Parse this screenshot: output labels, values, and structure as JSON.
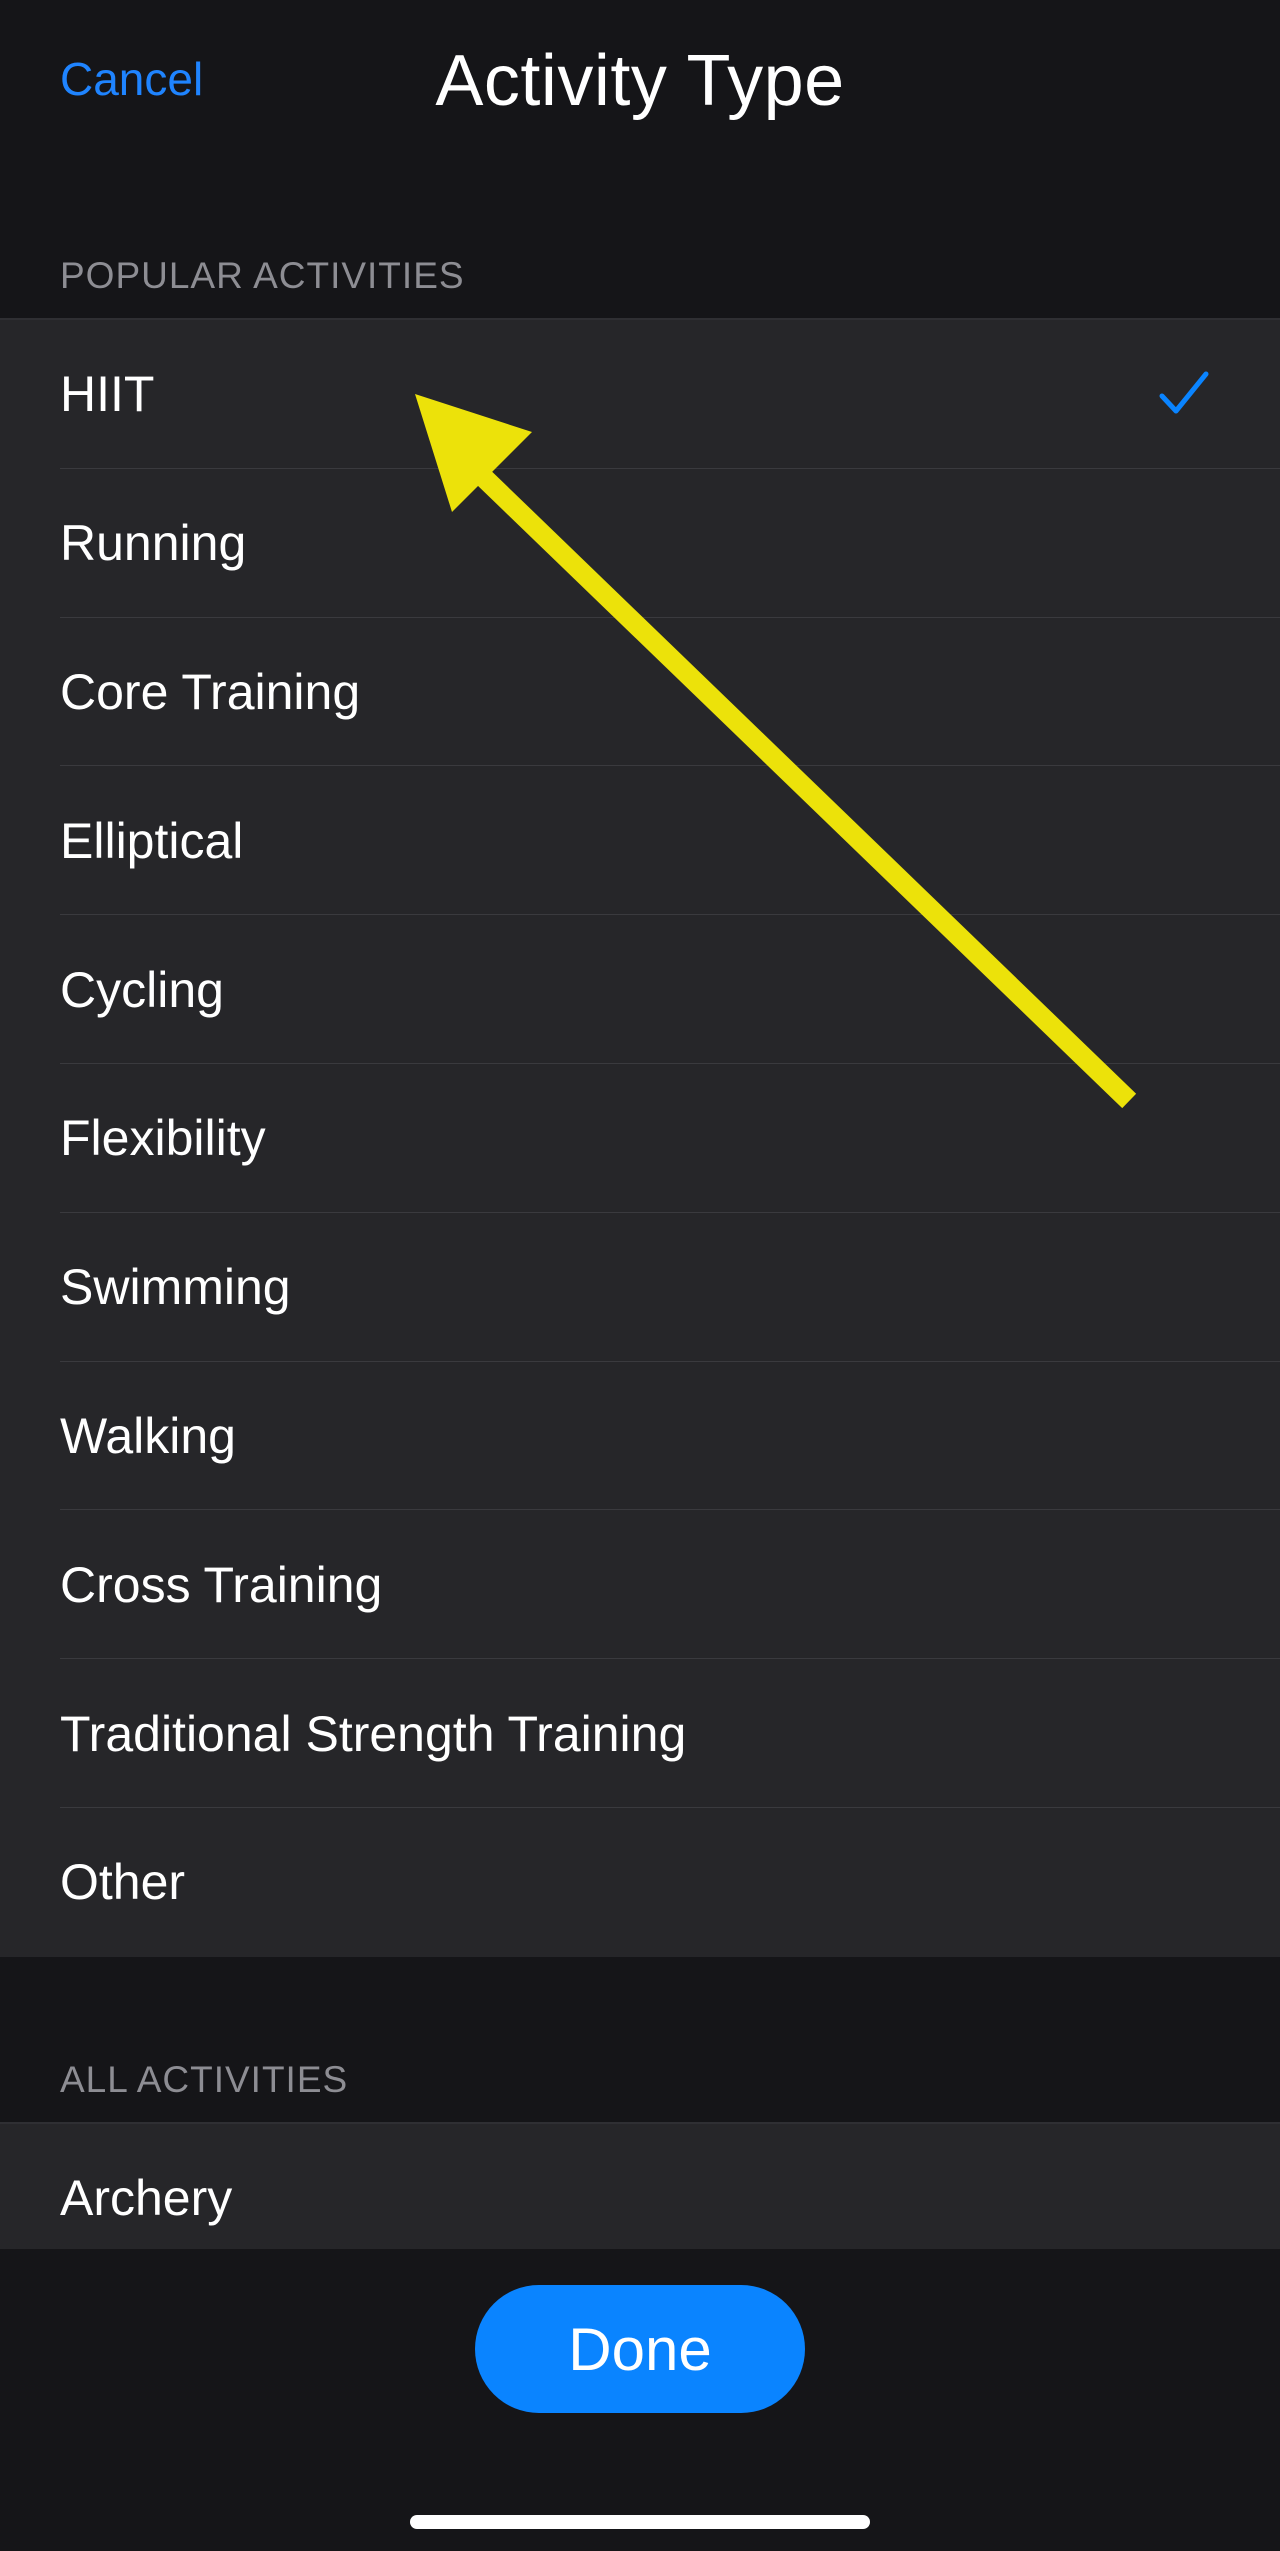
{
  "header": {
    "cancel_label": "Cancel",
    "title": "Activity Type"
  },
  "popular": {
    "header": "POPULAR ACTIVITIES",
    "items": [
      {
        "label": "HIIT",
        "selected": true
      },
      {
        "label": "Running",
        "selected": false
      },
      {
        "label": "Core Training",
        "selected": false
      },
      {
        "label": "Elliptical",
        "selected": false
      },
      {
        "label": "Cycling",
        "selected": false
      },
      {
        "label": "Flexibility",
        "selected": false
      },
      {
        "label": "Swimming",
        "selected": false
      },
      {
        "label": "Walking",
        "selected": false
      },
      {
        "label": "Cross Training",
        "selected": false
      },
      {
        "label": "Traditional Strength Training",
        "selected": false
      },
      {
        "label": "Other",
        "selected": false
      }
    ]
  },
  "all": {
    "header": "ALL ACTIVITIES",
    "items": [
      {
        "label": "Archery"
      }
    ]
  },
  "footer": {
    "done_label": "Done"
  },
  "icons": {
    "checkmark": "checkmark-icon"
  },
  "colors": {
    "accent": "#0a84ff",
    "link": "#1f84ff",
    "annotation_arrow": "#ece20a",
    "background": "#151518",
    "cell_background": "#262629",
    "secondary_text": "#8d8d93"
  }
}
